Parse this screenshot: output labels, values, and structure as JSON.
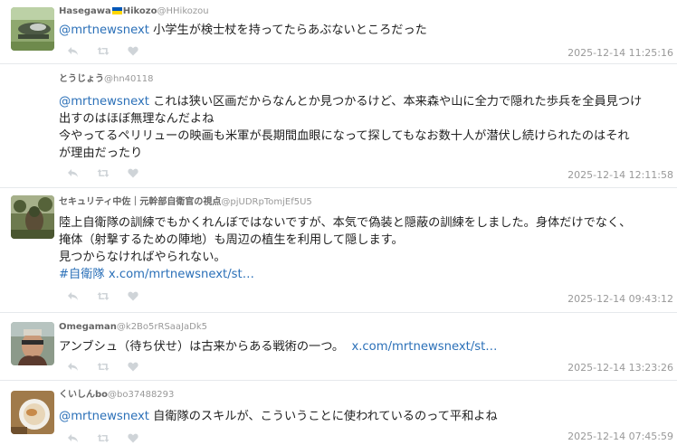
{
  "tweets": [
    {
      "name": "Hasegawa",
      "name_suffix": "Hikozo",
      "handle": "@HHikozou",
      "mention": "@mrtnewsnext",
      "lines": [
        "小学生が検士杖を持ってたらあぶないところだった"
      ],
      "timestamp": "2025-12-14 11:25:16"
    },
    {
      "name": "とうじょう",
      "handle": "@hn40118",
      "mention": "@mrtnewsnext",
      "lines": [
        "これは狭い区画だからなんとか見つかるけど、本来森や山に全力で隠れた歩兵を全員見つけ",
        "出すのはほぼ無理なんだよね",
        "今やってるペリリューの映画も米軍が長期間血眼になって探してもなお数十人が潜伏し続けられたのはそれ",
        "が理由だったり"
      ],
      "timestamp": "2025-12-14 12:11:58"
    },
    {
      "name": "セキュリティ中佐｜元幹部自衛官の視点",
      "handle": "@pjUDRpTomjEf5U5",
      "lines": [
        "陸上自衛隊の訓練でもかくれんぼではないですが、本気で偽装と隠蔽の訓練をしました。身体だけでなく、",
        "掩体（射撃するための陣地）も周辺の植生を利用して隠します。",
        "見つからなければやられない。"
      ],
      "hashtag": "#自衛隊",
      "link": "x.com/mrtnewsnext/st…",
      "timestamp": "2025-12-14 09:43:12"
    },
    {
      "name": "Omegaman",
      "handle": "@k2Bo5rRSaaJaDk5",
      "text": "アンブシュ（待ち伏せ）は古来からある戦術の一つ。",
      "link": "x.com/mrtnewsnext/st…",
      "timestamp": "2025-12-14 13:23:26"
    },
    {
      "name": "くいしんbo",
      "handle": "@bo37488293",
      "mention": "@mrtnewsnext",
      "lines": [
        "自衛隊のスキルが、こういうことに使われているのって平和よね"
      ],
      "timestamp": "2025-12-14 07:45:59"
    }
  ],
  "icons": {
    "reply": "reply-icon",
    "retweet": "retweet-icon",
    "like": "heart-icon"
  },
  "colors": {
    "link": "#2b70b8",
    "name": "#666666",
    "handle": "#999999",
    "action_icon": "#cfd4d8",
    "divider": "#e6e9ec"
  }
}
